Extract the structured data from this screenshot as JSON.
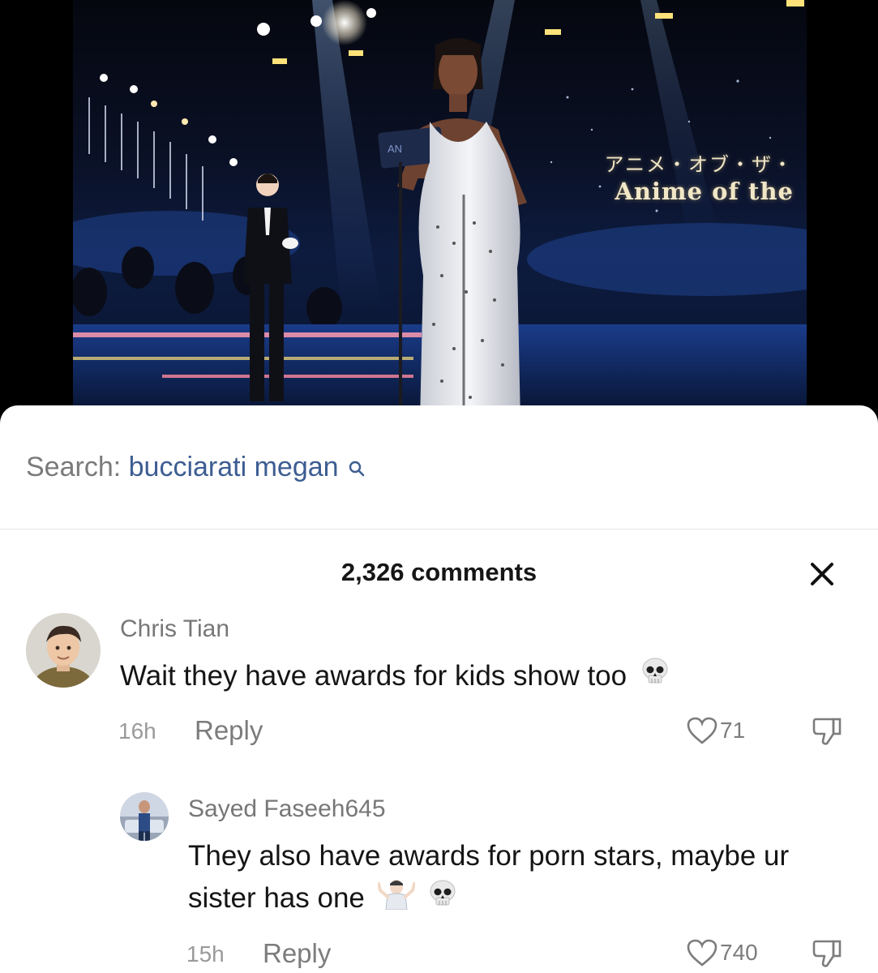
{
  "video": {
    "caption_jp": "アニメ・オブ・ザ・",
    "caption_en": "Anime of the"
  },
  "search": {
    "prefix": "Search:",
    "term": "bucciarati megan"
  },
  "comments_header": {
    "count_label": "2,326 comments"
  },
  "comments": [
    {
      "username": "Chris Tian",
      "text": "Wait they have awards for kids show too",
      "emoji": [
        "skull-emoji"
      ],
      "time": "16h",
      "reply_label": "Reply",
      "likes": "71"
    },
    {
      "username": "Sayed Faseeh645",
      "text": "They also have awards for porn stars, maybe ur sister has one",
      "emoji": [
        "shrug-emoji",
        "skull-emoji"
      ],
      "time": "15h",
      "reply_label": "Reply",
      "likes": "740"
    }
  ],
  "colors": {
    "search_term": "#3d5d92",
    "muted_text": "#7c7c7c",
    "sheet_background": "#ffffff",
    "page_background": "#000000"
  }
}
